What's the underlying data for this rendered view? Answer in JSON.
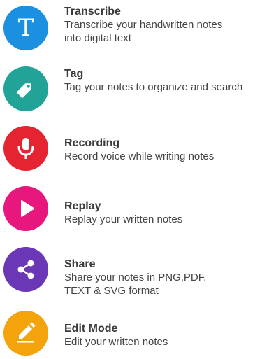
{
  "colors": {
    "transcribe": "#1b8fe0",
    "tag": "#22a397",
    "recording": "#e52431",
    "replay": "#e8177e",
    "share": "#6a37b6",
    "edit": "#f5a30c"
  },
  "features": [
    {
      "icon": "letter-t-icon",
      "title": "Transcribe",
      "desc_lines": [
        "Transcribe your handwritten notes",
        "into digital text"
      ]
    },
    {
      "icon": "tag-icon",
      "title": "Tag",
      "desc_lines": [
        "Tag your notes to organize and search"
      ]
    },
    {
      "icon": "microphone-icon",
      "title": "Recording",
      "desc_lines": [
        "Record voice while writing notes"
      ]
    },
    {
      "icon": "play-icon",
      "title": "Replay",
      "desc_lines": [
        "Replay your written notes"
      ]
    },
    {
      "icon": "share-icon",
      "title": "Share",
      "desc_lines": [
        "Share your notes in PNG,PDF,",
        "TEXT & SVG format"
      ]
    },
    {
      "icon": "pencil-icon",
      "title": "Edit Mode",
      "desc_lines": [
        "Edit your written notes"
      ]
    }
  ]
}
